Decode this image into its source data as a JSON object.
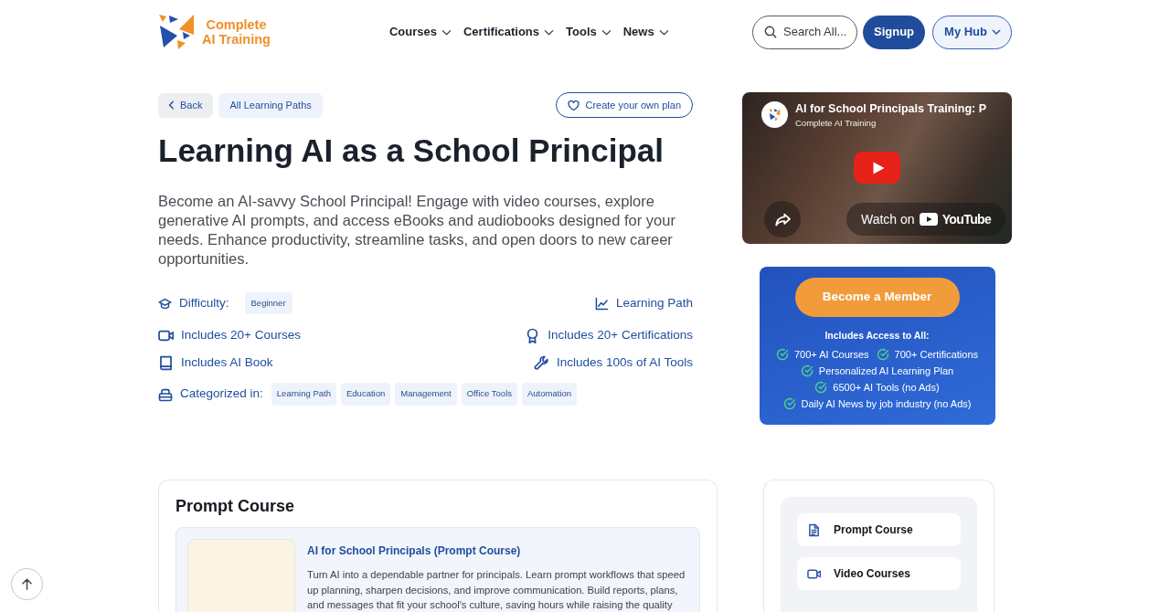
{
  "header": {
    "logo_lines": [
      "Complete",
      "AI Training"
    ],
    "nav": [
      "Courses",
      "Certifications",
      "Tools",
      "News"
    ],
    "search_label": "Search All...",
    "signup": "Signup",
    "hub": "My Hub"
  },
  "path": {
    "back": "Back",
    "all_paths": "All Learning Paths",
    "create_plan": "Create your own plan",
    "title": "Learning AI as a School Principal",
    "description": "Become an AI-savvy School Principal! Engage with video courses, explore generative AI prompts, and access eBooks and audiobooks designed for your needs. Enhance productivity, streamline tasks, and open doors to new career opportunities.",
    "difficulty_label": "Difficulty:",
    "difficulty": "Beginner",
    "path_type": "Learning Path",
    "includes": [
      "Includes 20+ Courses",
      "Includes 20+ Certifications",
      "Includes AI Book",
      "Includes 100s of AI Tools"
    ],
    "categories_label": "Categorized in:",
    "categories": [
      "Learning Path",
      "Education",
      "Management",
      "Office Tools",
      "Automation"
    ]
  },
  "video": {
    "title": "AI for School Principals Training: P",
    "channel": "Complete AI Training",
    "watch_on": "Watch on",
    "platform": "YouTube"
  },
  "membership": {
    "button": "Become a Member",
    "heading": "Includes Access to All:",
    "benefit_rows": [
      [
        "700+ AI Courses",
        "700+ Certifications"
      ],
      [
        "Personalized AI Learning Plan"
      ],
      [
        "6500+ AI Tools (no Ads)"
      ],
      [
        "Daily AI News by job industry (no Ads)"
      ]
    ]
  },
  "prompt_course": {
    "heading": "Prompt Course",
    "title": "AI for School Principals (Prompt Course)",
    "description": "Turn AI into a dependable partner for principals. Learn prompt workflows that speed up planning, sharpen decisions, and improve communication. Build reports, plans, and messages that fit your school's culture, saving hours while raising the quality"
  },
  "section_menu": [
    "Prompt Course",
    "Video Courses"
  ]
}
